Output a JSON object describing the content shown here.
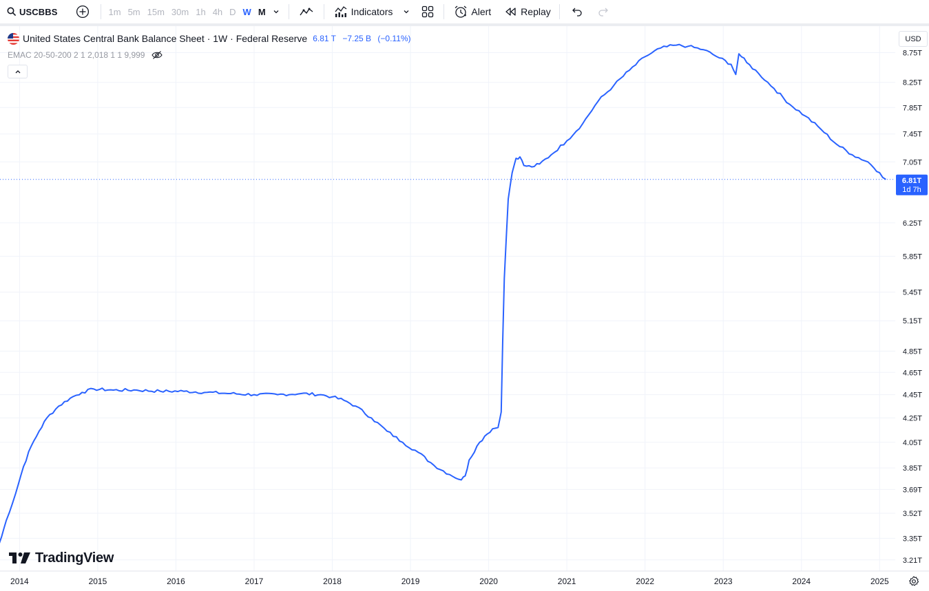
{
  "toolbar": {
    "symbol": "USCBBS",
    "intervals": [
      "1m",
      "5m",
      "15m",
      "30m",
      "1h",
      "4h",
      "D",
      "W",
      "M"
    ],
    "active_interval": "W",
    "indicators_label": "Indicators",
    "alert_label": "Alert",
    "replay_label": "Replay",
    "icons": [
      "search-icon",
      "plus-circle-icon",
      "chevron-down-icon",
      "line-chart-icon",
      "indicators-icon",
      "layout-grid-icon",
      "alarm-clock-icon",
      "replay-icon",
      "undo-icon",
      "redo-icon"
    ]
  },
  "legend": {
    "title": "United States Central Bank Balance Sheet · 1W · Federal Reserve",
    "last_value": "6.81 T",
    "change": "−7.25 B",
    "change_pct": "(−0.11%)",
    "indicator": "EMAC 20-50-200 2 1 2,018 1 1 9,999"
  },
  "currency": "USD",
  "logo_text": "TradingView",
  "colors": {
    "line": "#2962ff",
    "grid": "#f0f3fa",
    "text": "#131722",
    "muted": "#b2b5be"
  },
  "chart_data": {
    "type": "line",
    "title": "United States Central Bank Balance Sheet",
    "y_unit": "T",
    "ylim": [
      3.14,
      9.22
    ],
    "xlim": [
      2013.75,
      2025.2
    ],
    "grid": true,
    "y_ticks": [
      "8.75T",
      "8.25T",
      "7.85T",
      "7.45T",
      "7.05T",
      "6.25T",
      "5.85T",
      "5.45T",
      "5.15T",
      "4.85T",
      "4.65T",
      "4.45T",
      "4.25T",
      "4.05T",
      "3.85T",
      "3.69T",
      "3.52T",
      "3.35T",
      "3.21T"
    ],
    "x_ticks": [
      "2014",
      "2015",
      "2016",
      "2017",
      "2018",
      "2019",
      "2020",
      "2021",
      "2022",
      "2023",
      "2024",
      "2025"
    ],
    "last_label": "6.81T",
    "countdown_label": "1d 7h",
    "last_value": 6.81,
    "series": [
      {
        "values": [
          [
            2013.73,
            3.3
          ],
          [
            2013.77,
            3.36
          ],
          [
            2013.83,
            3.47
          ],
          [
            2013.95,
            3.66
          ],
          [
            2014.05,
            3.86
          ],
          [
            2014.15,
            4.02
          ],
          [
            2014.25,
            4.14
          ],
          [
            2014.35,
            4.25
          ],
          [
            2014.5,
            4.35
          ],
          [
            2014.65,
            4.42
          ],
          [
            2014.8,
            4.47
          ],
          [
            2014.95,
            4.5
          ],
          [
            2015.2,
            4.49
          ],
          [
            2015.5,
            4.49
          ],
          [
            2015.8,
            4.48
          ],
          [
            2016.1,
            4.48
          ],
          [
            2016.4,
            4.47
          ],
          [
            2016.7,
            4.46
          ],
          [
            2017.0,
            4.45
          ],
          [
            2017.3,
            4.45
          ],
          [
            2017.6,
            4.46
          ],
          [
            2017.85,
            4.45
          ],
          [
            2018.0,
            4.43
          ],
          [
            2018.15,
            4.4
          ],
          [
            2018.3,
            4.35
          ],
          [
            2018.5,
            4.25
          ],
          [
            2018.7,
            4.14
          ],
          [
            2018.9,
            4.05
          ],
          [
            2019.1,
            3.97
          ],
          [
            2019.3,
            3.87
          ],
          [
            2019.5,
            3.8
          ],
          [
            2019.65,
            3.76
          ],
          [
            2019.7,
            3.79
          ],
          [
            2019.75,
            3.91
          ],
          [
            2019.85,
            4.02
          ],
          [
            2019.95,
            4.1
          ],
          [
            2020.05,
            4.16
          ],
          [
            2020.12,
            4.17
          ],
          [
            2020.16,
            4.3
          ],
          [
            2020.2,
            5.6
          ],
          [
            2020.25,
            6.55
          ],
          [
            2020.3,
            6.9
          ],
          [
            2020.35,
            7.1
          ],
          [
            2020.4,
            7.12
          ],
          [
            2020.45,
            7.0
          ],
          [
            2020.55,
            6.98
          ],
          [
            2020.65,
            7.02
          ],
          [
            2020.8,
            7.15
          ],
          [
            2021.0,
            7.35
          ],
          [
            2021.2,
            7.6
          ],
          [
            2021.4,
            7.95
          ],
          [
            2021.6,
            8.2
          ],
          [
            2021.8,
            8.45
          ],
          [
            2022.0,
            8.68
          ],
          [
            2022.2,
            8.83
          ],
          [
            2022.4,
            8.88
          ],
          [
            2022.55,
            8.86
          ],
          [
            2022.75,
            8.8
          ],
          [
            2022.95,
            8.66
          ],
          [
            2023.1,
            8.55
          ],
          [
            2023.16,
            8.38
          ],
          [
            2023.2,
            8.73
          ],
          [
            2023.3,
            8.58
          ],
          [
            2023.45,
            8.4
          ],
          [
            2023.65,
            8.15
          ],
          [
            2023.85,
            7.9
          ],
          [
            2024.05,
            7.72
          ],
          [
            2024.25,
            7.52
          ],
          [
            2024.45,
            7.3
          ],
          [
            2024.65,
            7.15
          ],
          [
            2024.85,
            7.05
          ],
          [
            2025.0,
            6.9
          ],
          [
            2025.08,
            6.81
          ]
        ]
      }
    ]
  }
}
